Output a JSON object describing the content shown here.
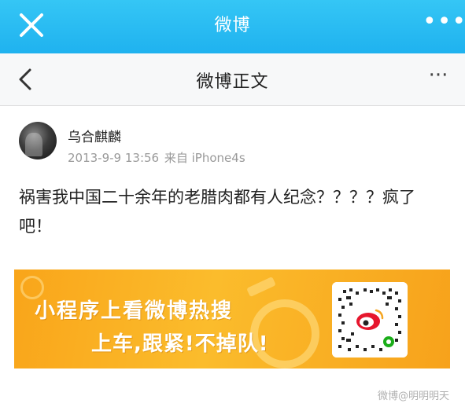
{
  "header": {
    "app_title": "微博",
    "close_icon": "close-icon",
    "more_icon": "more-horizontal-icon",
    "more_label": "•••",
    "background_color": "#27b8f2"
  },
  "nav": {
    "title": "微博正文",
    "back_icon": "chevron-left-icon",
    "more_label": "···"
  },
  "post": {
    "username": "乌合麒麟",
    "timestamp": "2013-9-9 13:56",
    "source": "来自 iPhone4s",
    "text": "祸害我中国二十余年的老腊肉都有人纪念？？？？疯了吧！"
  },
  "banner": {
    "line1": "小程序上看微博热搜",
    "line2": "上车,跟紧!不掉队!",
    "qr_icon": "weibo-qr-code-icon",
    "background_color": "#f9a51a"
  },
  "watermark": "微博@明明明天"
}
